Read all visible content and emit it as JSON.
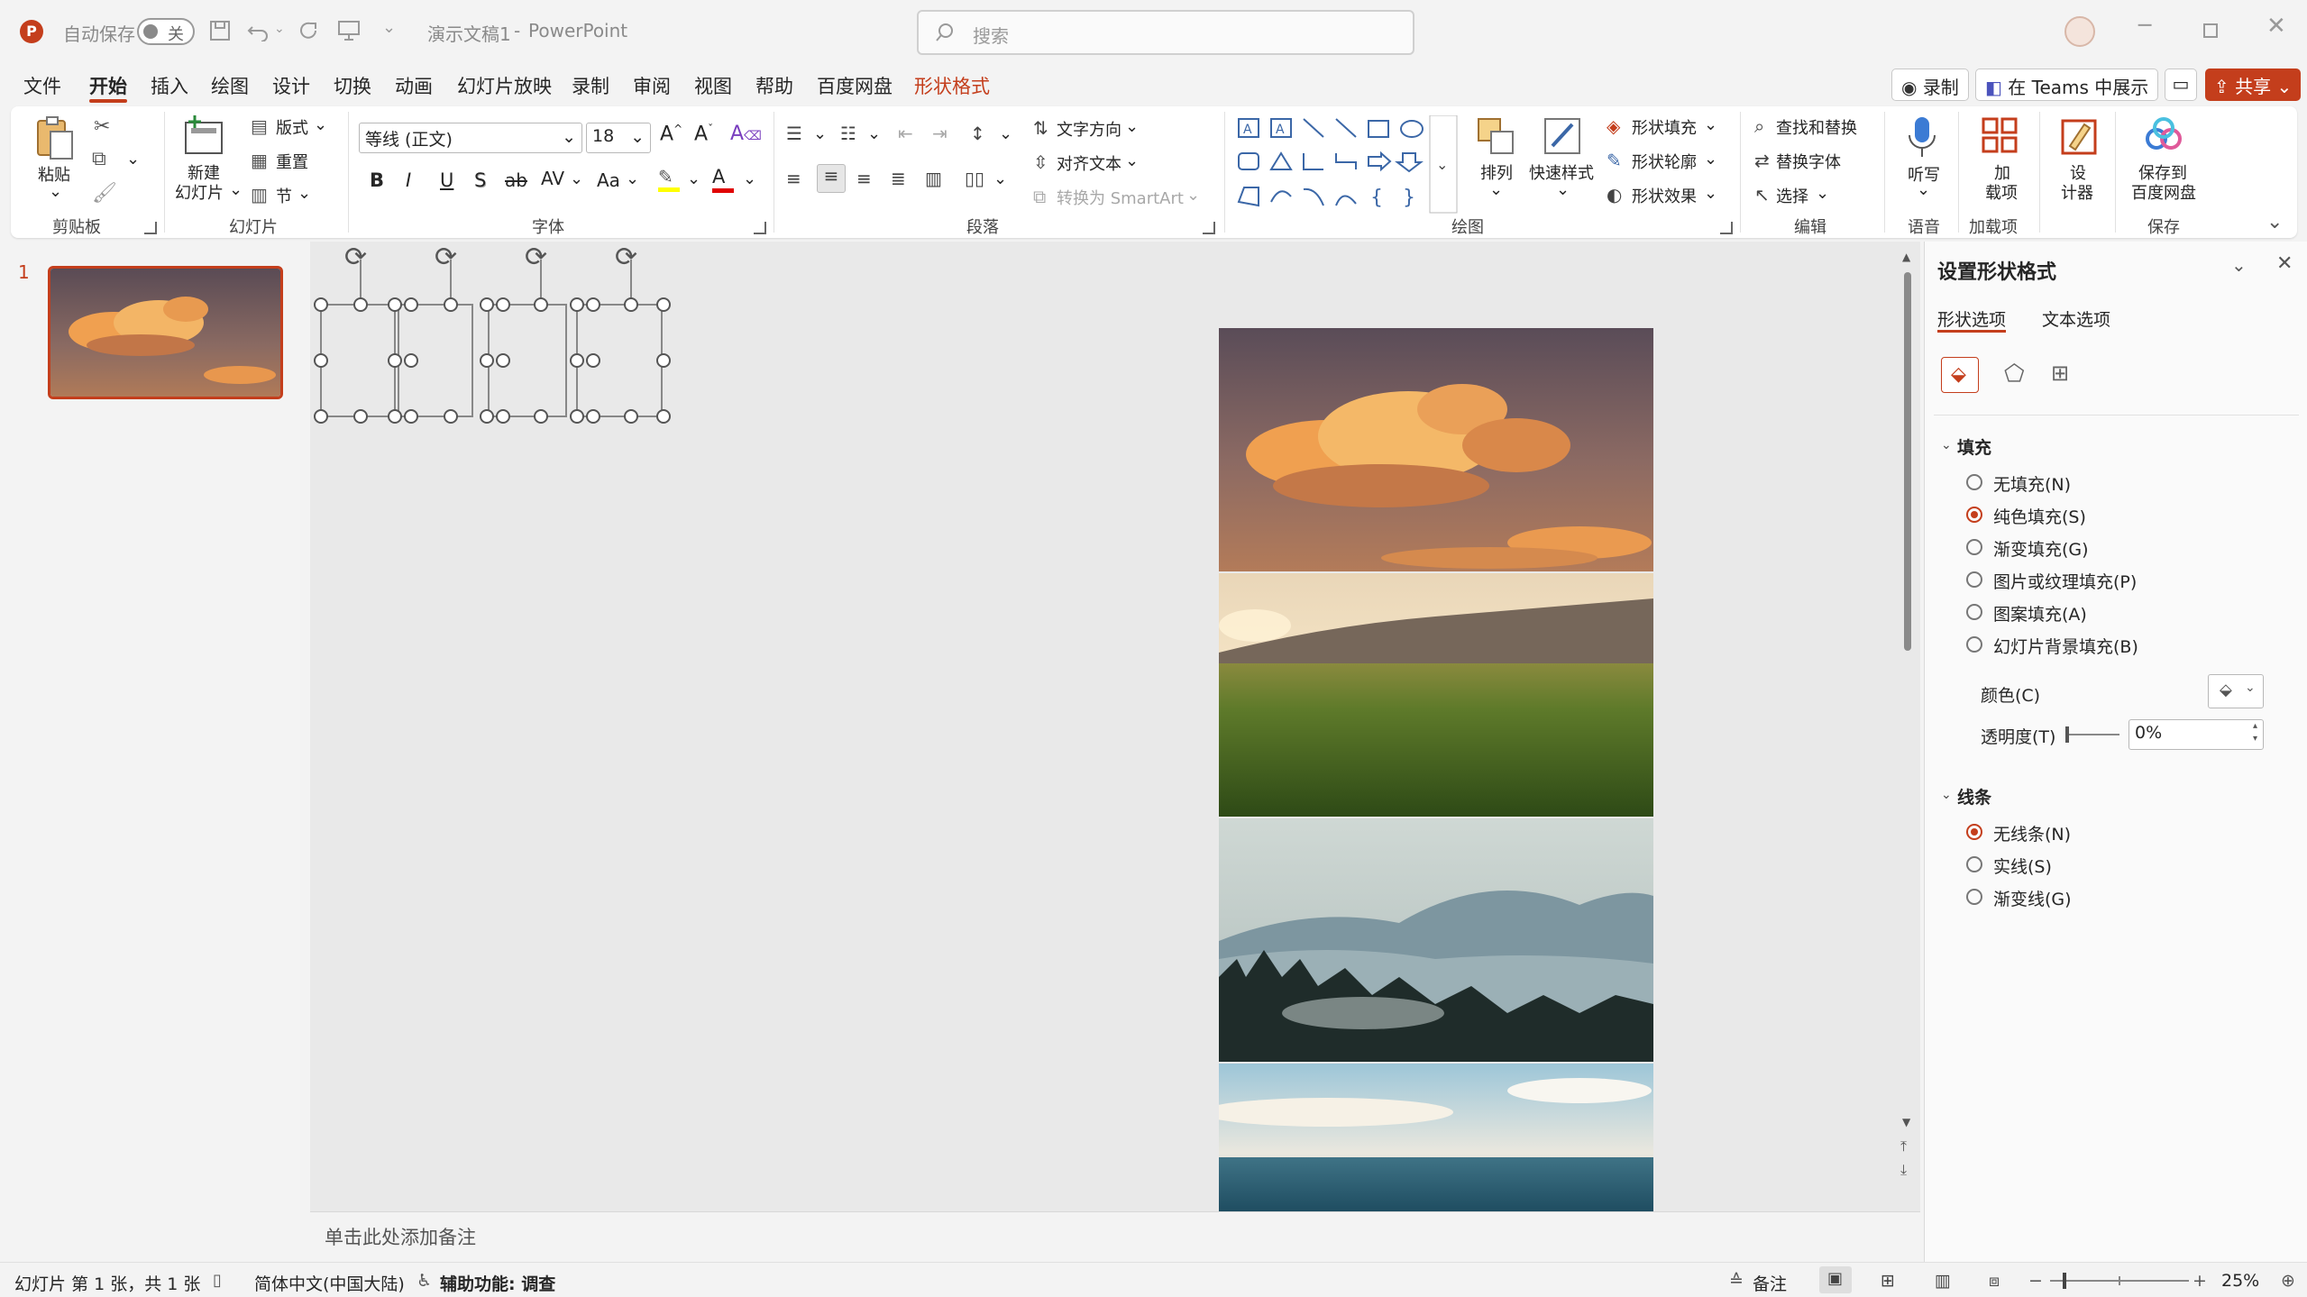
{
  "titlebar": {
    "autosave_label": "自动保存",
    "autosave_state": "关",
    "doc_title": "演示文稿1",
    "separator": "-",
    "app_name": "PowerPoint",
    "search_placeholder": "搜索"
  },
  "menu": {
    "tabs": [
      {
        "label": "文件",
        "active": false
      },
      {
        "label": "开始",
        "active": true
      },
      {
        "label": "插入",
        "active": false
      },
      {
        "label": "绘图",
        "active": false
      },
      {
        "label": "设计",
        "active": false
      },
      {
        "label": "切换",
        "active": false
      },
      {
        "label": "动画",
        "active": false
      },
      {
        "label": "幻灯片放映",
        "active": false
      },
      {
        "label": "录制",
        "active": false
      },
      {
        "label": "审阅",
        "active": false
      },
      {
        "label": "视图",
        "active": false
      },
      {
        "label": "帮助",
        "active": false
      },
      {
        "label": "百度网盘",
        "active": false
      },
      {
        "label": "形状格式",
        "active": false
      }
    ],
    "record_btn": "录制",
    "teams_btn": "在 Teams 中展示",
    "share_btn": "共享"
  },
  "ribbon": {
    "clipboard": {
      "paste": "粘贴",
      "group": "剪贴板"
    },
    "slides": {
      "new_slide_1": "新建",
      "new_slide_2": "幻灯片",
      "layout": "版式",
      "reset": "重置",
      "section": "节",
      "group": "幻灯片"
    },
    "font": {
      "font_name": "等线 (正文)",
      "font_size": "18",
      "bold": "B",
      "italic": "I",
      "underline": "U",
      "shadow": "S",
      "strike": "ab",
      "spacing": "AV",
      "case": "Aa",
      "color_a": "A",
      "group": "字体"
    },
    "paragraph": {
      "text_direction": "文字方向",
      "align_text": "对齐文本",
      "smartart": "转换为 SmartArt",
      "group": "段落"
    },
    "drawing": {
      "arrange": "排列",
      "quick_styles": "快速样式",
      "shape_fill": "形状填充",
      "shape_outline": "形状轮廓",
      "shape_effects": "形状效果",
      "group": "绘图"
    },
    "editing": {
      "find_replace": "查找和替换",
      "replace_font": "替换字体",
      "select": "选择",
      "group": "编辑"
    },
    "voice": {
      "dictate": "听写",
      "group": "语音"
    },
    "addins": {
      "addins_1": "加",
      "addins_2": "载项",
      "group": "加载项"
    },
    "designer": {
      "label_1": "设",
      "label_2": "计器"
    },
    "save": {
      "label_1": "保存到",
      "label_2": "百度网盘",
      "group": "保存"
    }
  },
  "thumbnails": {
    "slide_number": "1"
  },
  "notes": {
    "placeholder": "单击此处添加备注"
  },
  "format_pane": {
    "title": "设置形状格式",
    "tab_shape": "形状选项",
    "tab_text": "文本选项",
    "fill_section": "填充",
    "fill_options": [
      {
        "label": "无填充(N)",
        "selected": false
      },
      {
        "label": "纯色填充(S)",
        "selected": true
      },
      {
        "label": "渐变填充(G)",
        "selected": false
      },
      {
        "label": "图片或纹理填充(P)",
        "selected": false
      },
      {
        "label": "图案填充(A)",
        "selected": false
      },
      {
        "label": "幻灯片背景填充(B)",
        "selected": false
      }
    ],
    "color_label": "颜色(C)",
    "transparency_label": "透明度(T)",
    "transparency_value": "0%",
    "line_section": "线条",
    "line_options": [
      {
        "label": "无线条(N)",
        "selected": true
      },
      {
        "label": "实线(S)",
        "selected": false
      },
      {
        "label": "渐变线(G)",
        "selected": false
      }
    ]
  },
  "statusbar": {
    "slide_info": "幻灯片 第 1 张，共 1 张",
    "language": "简体中文(中国大陆)",
    "accessibility": "辅助功能: 调查",
    "notes_btn": "备注",
    "zoom": "25%"
  },
  "colors": {
    "accent": "#c43e1c",
    "background": "#f3f3f3",
    "canvas": "#e9e9e9"
  }
}
